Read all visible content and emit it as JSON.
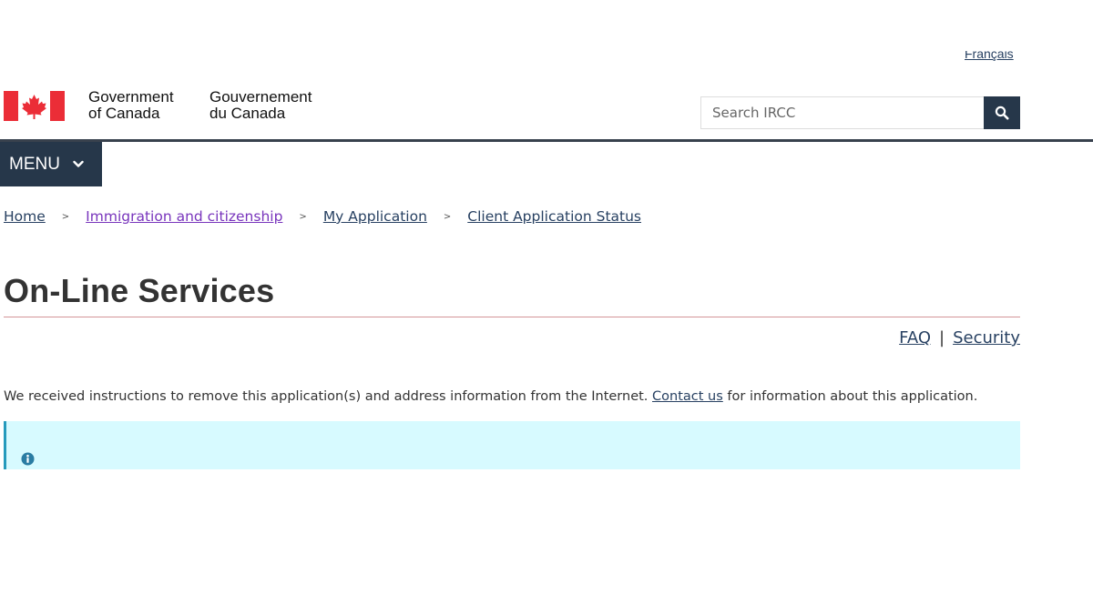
{
  "header": {
    "language_link": "Français",
    "signature_en_line1": "Government",
    "signature_en_line2": "of Canada",
    "signature_fr_line1": "Gouvernement",
    "signature_fr_line2": "du Canada",
    "search_placeholder": "Search IRCC",
    "search_icon": "search-icon",
    "menu_label": "MENU",
    "menu_icon": "chevron-down-icon"
  },
  "breadcrumb": [
    {
      "label": "Home"
    },
    {
      "label": "Immigration and citizenship"
    },
    {
      "label": "My Application"
    },
    {
      "label": "Client Application Status"
    }
  ],
  "page": {
    "title": "On-Line Services",
    "faq_label": "FAQ",
    "separator": "|",
    "security_label": "Security",
    "notice_before": "We received instructions to remove this application(s) and address information from the Internet. ",
    "notice_link": "Contact us",
    "notice_after": " for information about this application.",
    "info_icon": "info-icon"
  },
  "colors": {
    "brand_dark": "#26374a",
    "flag_red": "#eb2d37",
    "link": "#284162",
    "visited_link": "#7834bc",
    "info_background": "#d7faff",
    "info_accent": "#269abc"
  }
}
